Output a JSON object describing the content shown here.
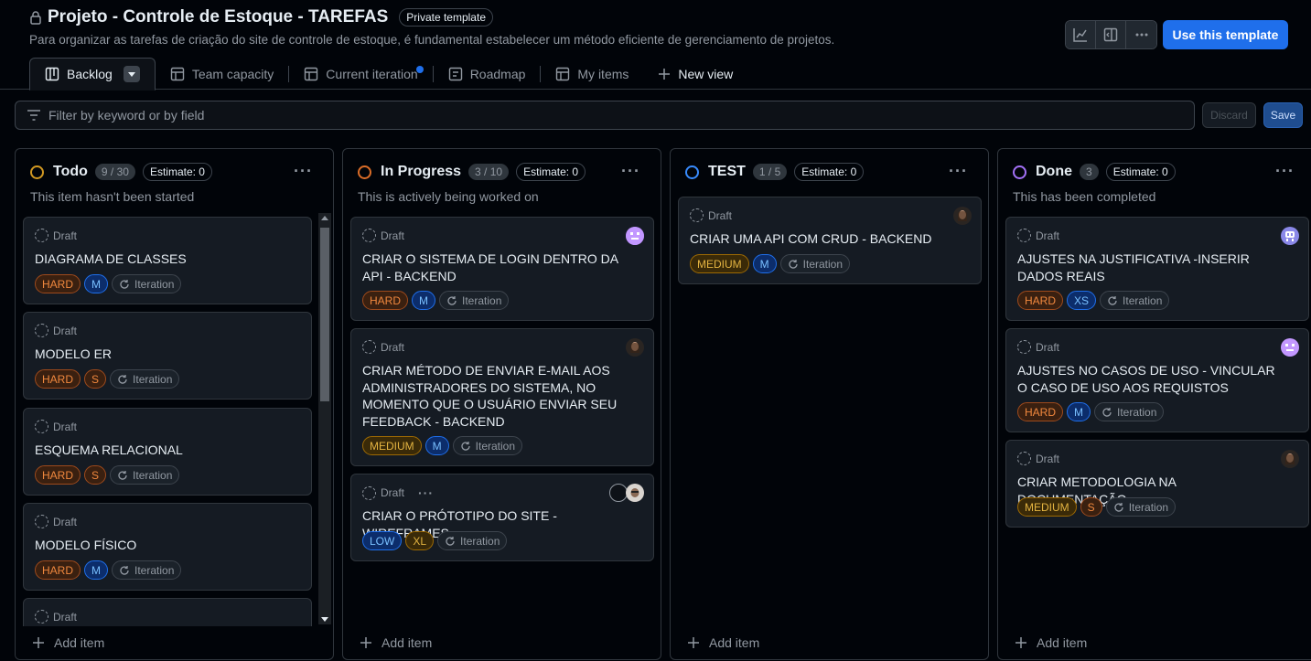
{
  "header": {
    "title": "Projeto - Controle de Estoque - TAREFAS",
    "badge": "Private template",
    "description": "Para organizar as tarefas de criação do site de controle de estoque, é fundamental estabelecer um método eficiente de gerenciamento de projetos.",
    "use_template": "Use this template",
    "icons": [
      "lock-icon",
      "insights-icon",
      "panel-icon",
      "kebab-icon"
    ]
  },
  "tabs": [
    {
      "label": "Backlog",
      "icon": "board-icon",
      "active": true
    },
    {
      "label": "Team capacity",
      "icon": "table-icon"
    },
    {
      "label": "Current iteration",
      "icon": "table-icon",
      "dot": true
    },
    {
      "label": "Roadmap",
      "icon": "roadmap-icon"
    },
    {
      "label": "My items",
      "icon": "table-icon"
    },
    {
      "label": "New view",
      "icon": "plus-icon"
    }
  ],
  "filter": {
    "placeholder": "Filter by keyword or by field"
  },
  "actions": {
    "discard": "Discard",
    "save": "Save"
  },
  "common": {
    "draft": "Draft",
    "iteration": "Iteration",
    "add_item": "Add item"
  },
  "columns": [
    {
      "name": "Todo",
      "count": "9 / 30",
      "estimate": "Estimate: 0",
      "description": "This item hasn't been started",
      "color": "#d29922",
      "cards": [
        {
          "title": "DIAGRAMA DE CLASSES",
          "priority": "HARD",
          "size": "M"
        },
        {
          "title": "MODELO ER",
          "priority": "HARD",
          "size": "S"
        },
        {
          "title": "ESQUEMA RELACIONAL",
          "priority": "HARD",
          "size": "S"
        },
        {
          "title": "MODELO FÍSICO",
          "priority": "HARD",
          "size": "M"
        }
      ]
    },
    {
      "name": "In Progress",
      "count": "3 / 10",
      "estimate": "Estimate: 0",
      "description": "This is actively being worked on",
      "color": "#db6d28",
      "cards": [
        {
          "title": "CRIAR O SISTEMA DE LOGIN DENTRO DA API - BACKEND",
          "priority": "HARD",
          "size": "M"
        },
        {
          "title": "CRIAR MÉTODO DE ENVIAR E-MAIL AOS ADMINISTRADORES DO SISTEMA, NO MOMENTO QUE O USUÁRIO ENVIAR SEU FEEDBACK - BACKEND",
          "priority": "MEDIUM",
          "size": "M"
        },
        {
          "title": "CRIAR O PRÓTOTIPO DO SITE - WIREFRAMES",
          "priority": "LOW",
          "size": "XL"
        }
      ]
    },
    {
      "name": "TEST",
      "count": "1 / 5",
      "estimate": "Estimate: 0",
      "description": "",
      "color": "#388bfd",
      "cards": [
        {
          "title": "CRIAR UMA API COM CRUD - BACKEND",
          "priority": "MEDIUM",
          "size": "M"
        }
      ]
    },
    {
      "name": "Done",
      "count": "3",
      "estimate": "Estimate: 0",
      "description": "This has been completed",
      "color": "#a371f7",
      "cards": [
        {
          "title": "AJUSTES NA JUSTIFICATIVA -INSERIR DADOS REAIS",
          "priority": "HARD",
          "size": "XS"
        },
        {
          "title": "AJUSTES NO CASOS DE USO - VINCULAR O CASO DE USO AOS REQUISTOS",
          "priority": "HARD",
          "size": "M"
        },
        {
          "title": "CRIAR METODOLOGIA NA DOCUMENTAÇÃO",
          "priority": "MEDIUM",
          "size": "S"
        }
      ]
    }
  ]
}
